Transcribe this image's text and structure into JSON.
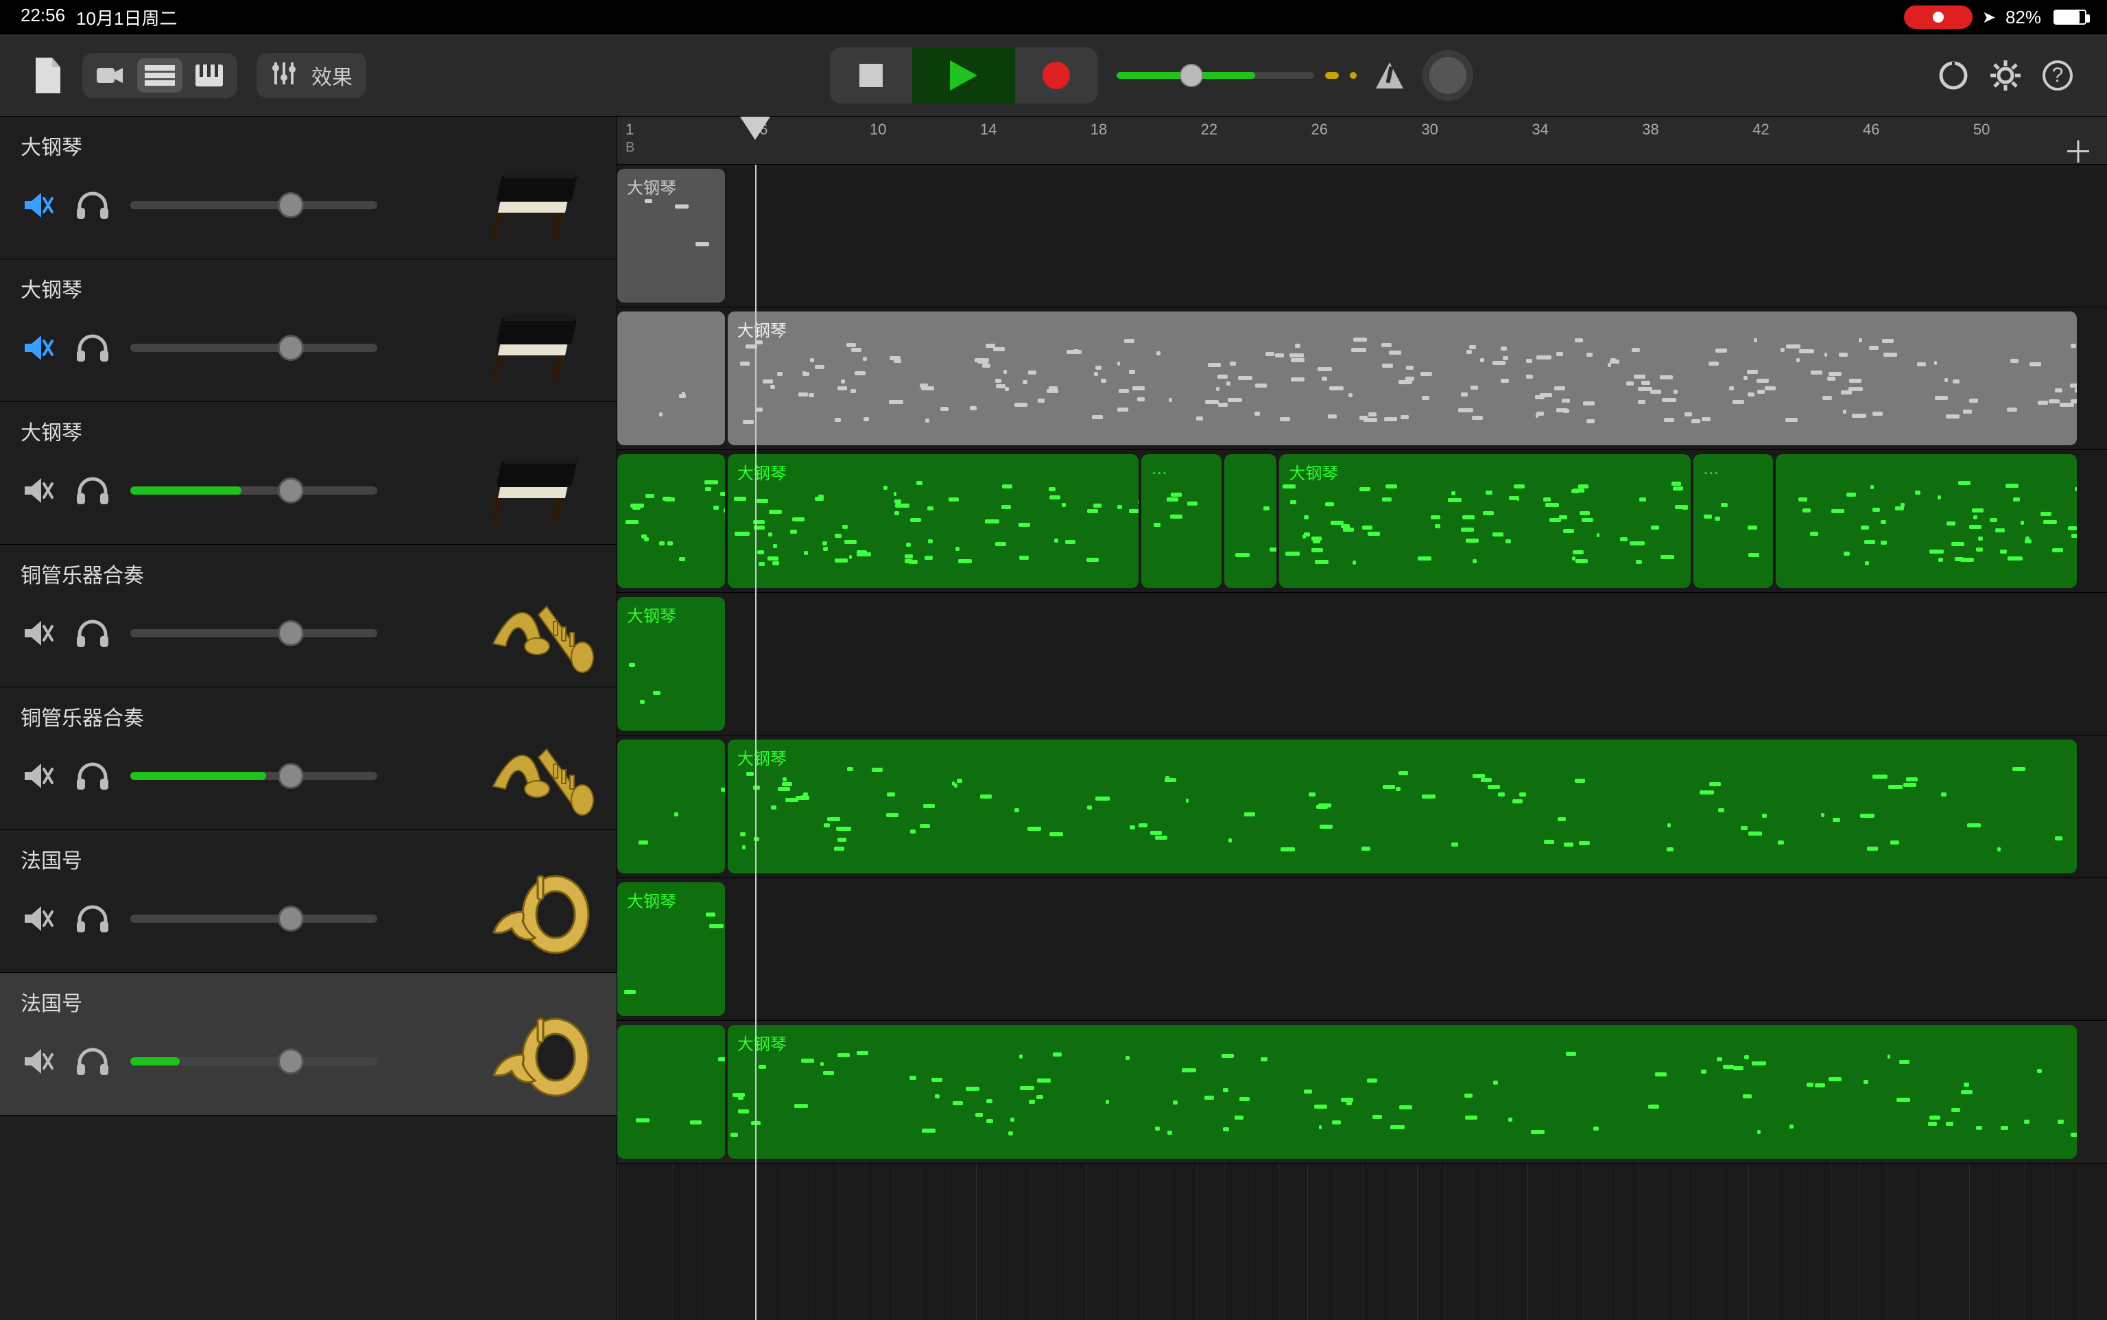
{
  "status": {
    "time": "22:56",
    "date": "10月1日周二",
    "battery_pct": "82%",
    "battery_fill": 82,
    "location_glyph": "➤"
  },
  "toolbar": {
    "fx_label": "效果"
  },
  "timeline": {
    "start_number": "1",
    "start_letter": "B",
    "ticks": [
      1,
      6,
      10,
      14,
      18,
      22,
      26,
      30,
      34,
      38,
      42,
      46,
      50
    ],
    "playhead_bar": 6,
    "bars_visible": 54
  },
  "tracks": [
    {
      "name": "大钢琴",
      "muted": true,
      "mute_color": "#3aa0ff",
      "meter": 0,
      "knob": 0.65,
      "instrument": "piano",
      "selected": false,
      "regions": [
        {
          "start": 1,
          "end": 5,
          "style": "grey",
          "label": "大钢琴",
          "density": "sparse"
        }
      ]
    },
    {
      "name": "大钢琴",
      "muted": true,
      "mute_color": "#3aa0ff",
      "meter": 0,
      "knob": 0.65,
      "instrument": "piano",
      "selected": false,
      "regions": [
        {
          "start": 1,
          "end": 5,
          "style": "grey-sel",
          "label": "",
          "density": "sparse"
        },
        {
          "start": 5,
          "end": 54,
          "style": "grey-sel",
          "label": "大钢琴",
          "density": "dense"
        }
      ]
    },
    {
      "name": "大钢琴",
      "muted": true,
      "mute_color": "#bbbbbb",
      "meter": 0.45,
      "knob": 0.65,
      "instrument": "piano",
      "selected": false,
      "regions": [
        {
          "start": 1,
          "end": 5,
          "style": "green",
          "label": "",
          "density": "dense"
        },
        {
          "start": 5,
          "end": 20,
          "style": "green",
          "label": "大钢琴",
          "density": "dense"
        },
        {
          "start": 20,
          "end": 23,
          "style": "green",
          "label": "…",
          "density": "mid"
        },
        {
          "start": 23,
          "end": 25,
          "style": "green",
          "label": "",
          "density": "mid"
        },
        {
          "start": 25,
          "end": 40,
          "style": "green",
          "label": "大钢琴",
          "density": "dense"
        },
        {
          "start": 40,
          "end": 43,
          "style": "green",
          "label": "…",
          "density": "mid"
        },
        {
          "start": 43,
          "end": 54,
          "style": "green",
          "label": "",
          "density": "dense"
        }
      ]
    },
    {
      "name": "铜管乐器合奏",
      "muted": true,
      "mute_color": "#bbbbbb",
      "meter": 0,
      "knob": 0.65,
      "instrument": "brass-section",
      "selected": false,
      "regions": [
        {
          "start": 1,
          "end": 5,
          "style": "green",
          "label": "大钢琴",
          "density": "sparse"
        }
      ]
    },
    {
      "name": "铜管乐器合奏",
      "muted": true,
      "mute_color": "#bbbbbb",
      "meter": 0.55,
      "knob": 0.65,
      "instrument": "brass-section",
      "selected": false,
      "regions": [
        {
          "start": 1,
          "end": 5,
          "style": "green",
          "label": "",
          "density": "sparse"
        },
        {
          "start": 5,
          "end": 54,
          "style": "green",
          "label": "大钢琴",
          "density": "mid"
        }
      ]
    },
    {
      "name": "法国号",
      "muted": true,
      "mute_color": "#bbbbbb",
      "meter": 0,
      "knob": 0.65,
      "instrument": "french-horn",
      "selected": false,
      "regions": [
        {
          "start": 1,
          "end": 5,
          "style": "green",
          "label": "大钢琴",
          "density": "sparse"
        }
      ]
    },
    {
      "name": "法国号",
      "muted": true,
      "mute_color": "#bbbbbb",
      "meter": 0.2,
      "knob": 0.65,
      "instrument": "french-horn",
      "selected": true,
      "regions": [
        {
          "start": 1,
          "end": 5,
          "style": "green",
          "label": "",
          "density": "sparse"
        },
        {
          "start": 5,
          "end": 54,
          "style": "green",
          "label": "大钢琴",
          "density": "mid"
        }
      ]
    }
  ],
  "lane_height": 208,
  "master_volume": {
    "pos": 0.38,
    "fill": 0.7
  }
}
